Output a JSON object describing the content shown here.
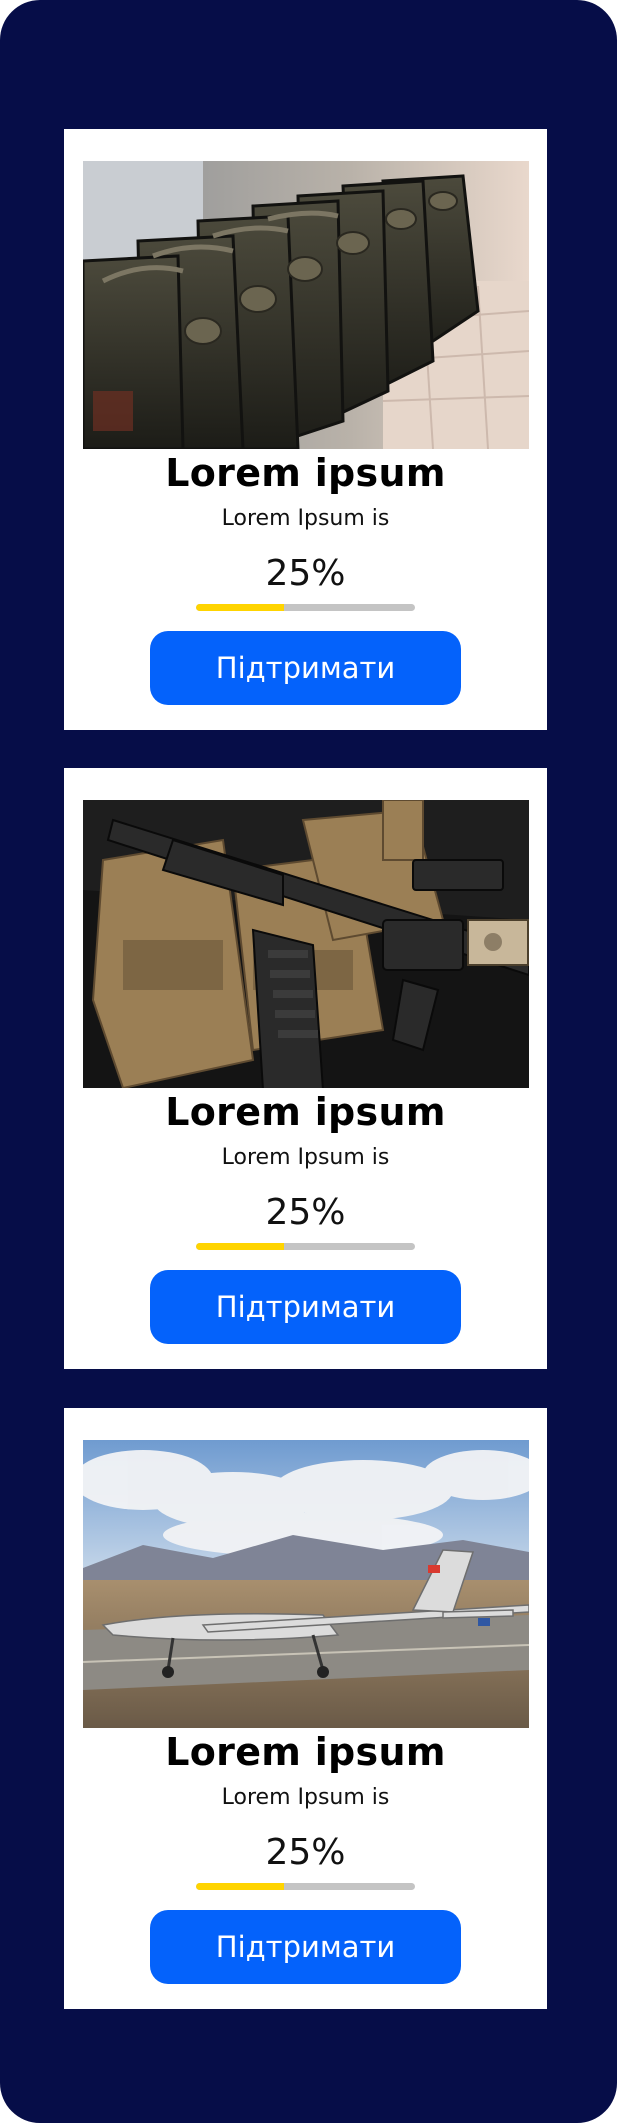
{
  "cards": [
    {
      "image": "jerry-cans-photo",
      "title": "Lorem ipsum",
      "subtitle": "Lorem Ipsum is",
      "progress_label": "25%",
      "progress_fraction": 0.4,
      "button_label": "Підтримати"
    },
    {
      "image": "rifle-and-gear-photo",
      "title": "Lorem ipsum",
      "subtitle": "Lorem Ipsum is",
      "progress_label": "25%",
      "progress_fraction": 0.4,
      "button_label": "Підтримати"
    },
    {
      "image": "drone-on-runway-photo",
      "title": "Lorem ipsum",
      "subtitle": "Lorem Ipsum is",
      "progress_label": "25%",
      "progress_fraction": 0.4,
      "button_label": "Підтримати"
    }
  ],
  "colors": {
    "background": "#060d48",
    "card": "#ffffff",
    "button": "#0462fb",
    "progress_fill": "#ffd400",
    "progress_track": "#c4c4c4"
  }
}
